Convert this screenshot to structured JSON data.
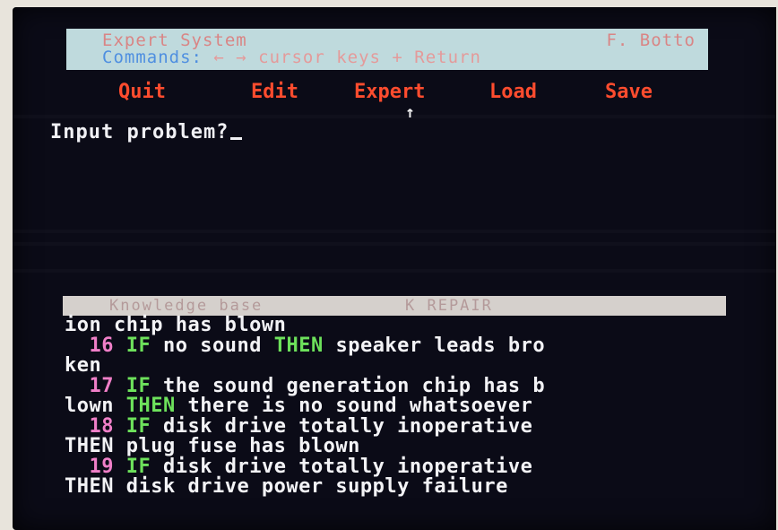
{
  "header": {
    "title": "Expert System",
    "author": "F. Botto",
    "commands_label": "Commands:",
    "commands_text": "← → cursor keys + Return"
  },
  "menu": {
    "quit": "Quit",
    "edit": "Edit",
    "expert": "Expert",
    "load": "Load",
    "save": "Save",
    "selected_marker": "↑"
  },
  "prompt": {
    "text": "Input problem?"
  },
  "knowledge_base": {
    "label": "Knowledge base",
    "name": "K REPAIR"
  },
  "rules": {
    "line0": "ion chip has blown",
    "r16_num": "16",
    "r16_if": "IF",
    "r16_cond": "no sound",
    "r16_then": "THEN",
    "r16_result": "speaker leads bro",
    "r16_cont": "ken",
    "r17_num": "17",
    "r17_if": "IF",
    "r17_cond": "the sound generation chip has b",
    "r17_cond2": "lown",
    "r17_then": "THEN",
    "r17_result": "there is no sound whatsoever",
    "r18_num": "18",
    "r18_if": "IF",
    "r18_cond": "disk drive totally inoperative",
    "r18_then": "THEN",
    "r18_result": "plug fuse has blown",
    "r19_num": "19",
    "r19_if": "IF",
    "r19_cond": "disk drive totally inoperative",
    "r19_then": "THEN",
    "r19_result": "disk drive power supply failure"
  },
  "colors": {
    "screen": "#0b0b17",
    "menu": "#ff4c2e",
    "keyword": "#6de15b",
    "rule_number": "#f07fc8",
    "text": "#f3f3f6"
  }
}
